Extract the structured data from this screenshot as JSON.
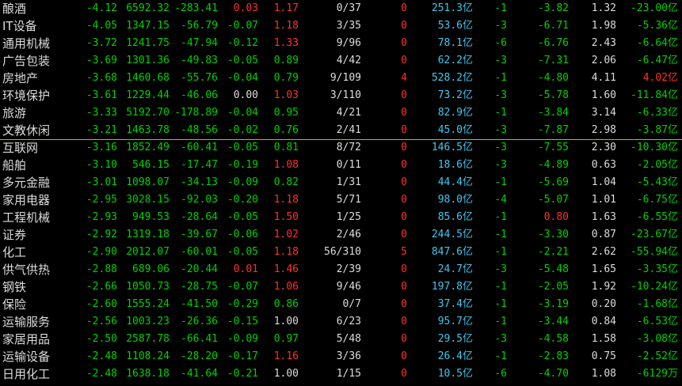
{
  "colors": {
    "background": "#000000",
    "rise": "#ff3030",
    "fall": "#00d200",
    "flat": "#dcdcdc",
    "amount": "#40c8f0",
    "divider": "#c8b400"
  },
  "rows": [
    {
      "name": "酿酒",
      "pct": "-4.12",
      "price": "6592.32",
      "chg": "-283.41",
      "spd": "0.03",
      "spd_dir": "up",
      "ratio": "1.17",
      "ratio_dir": "up",
      "ud": "0/37",
      "flag": "0",
      "flag_dir": "up",
      "amt": "251.3亿",
      "cnt": "-1",
      "val": "-3.82",
      "val_dir": "dn",
      "ratio2": "1.32",
      "flow": "-23.00亿",
      "flow_dir": "dn"
    },
    {
      "name": "IT设备",
      "pct": "-4.05",
      "price": "1347.15",
      "chg": "-56.79",
      "spd": "-0.07",
      "spd_dir": "dn",
      "ratio": "1.18",
      "ratio_dir": "up",
      "ud": "3/35",
      "flag": "0",
      "flag_dir": "up",
      "amt": "53.6亿",
      "cnt": "-3",
      "val": "-6.71",
      "val_dir": "dn",
      "ratio2": "1.98",
      "flow": "-5.36亿",
      "flow_dir": "dn"
    },
    {
      "name": "通用机械",
      "pct": "-3.72",
      "price": "1241.75",
      "chg": "-47.94",
      "spd": "-0.12",
      "spd_dir": "dn",
      "ratio": "1.33",
      "ratio_dir": "up",
      "ud": "9/96",
      "flag": "0",
      "flag_dir": "up",
      "amt": "78.1亿",
      "cnt": "-6",
      "val": "-6.76",
      "val_dir": "dn",
      "ratio2": "2.43",
      "flow": "-6.64亿",
      "flow_dir": "dn"
    },
    {
      "name": "广告包装",
      "pct": "-3.69",
      "price": "1301.36",
      "chg": "-49.83",
      "spd": "-0.05",
      "spd_dir": "dn",
      "ratio": "0.89",
      "ratio_dir": "dn",
      "ud": "4/42",
      "flag": "0",
      "flag_dir": "up",
      "amt": "62.2亿",
      "cnt": "-3",
      "val": "-7.31",
      "val_dir": "dn",
      "ratio2": "2.06",
      "flow": "-6.47亿",
      "flow_dir": "dn"
    },
    {
      "name": "房地产",
      "pct": "-3.68",
      "price": "1460.68",
      "chg": "-55.76",
      "spd": "-0.04",
      "spd_dir": "dn",
      "ratio": "0.79",
      "ratio_dir": "dn",
      "ud": "9/109",
      "flag": "4",
      "flag_dir": "up",
      "amt": "528.2亿",
      "cnt": "-1",
      "val": "-4.80",
      "val_dir": "dn",
      "ratio2": "4.11",
      "flow": "4.02亿",
      "flow_dir": "up"
    },
    {
      "name": "环境保护",
      "pct": "-3.61",
      "price": "1229.44",
      "chg": "-46.06",
      "spd": "0.00",
      "spd_dir": "eq",
      "ratio": "1.03",
      "ratio_dir": "up",
      "ud": "3/110",
      "flag": "0",
      "flag_dir": "up",
      "amt": "73.2亿",
      "cnt": "-3",
      "val": "-5.78",
      "val_dir": "dn",
      "ratio2": "1.60",
      "flow": "-11.84亿",
      "flow_dir": "dn"
    },
    {
      "name": "旅游",
      "pct": "-3.33",
      "price": "5192.70",
      "chg": "-178.89",
      "spd": "-0.04",
      "spd_dir": "dn",
      "ratio": "0.95",
      "ratio_dir": "dn",
      "ud": "4/21",
      "flag": "0",
      "flag_dir": "up",
      "amt": "82.9亿",
      "cnt": "-1",
      "val": "-3.84",
      "val_dir": "dn",
      "ratio2": "3.14",
      "flow": "-6.33亿",
      "flow_dir": "dn"
    },
    {
      "name": "文教休闲",
      "pct": "-3.21",
      "price": "1463.78",
      "chg": "-48.56",
      "spd": "-0.02",
      "spd_dir": "dn",
      "ratio": "0.76",
      "ratio_dir": "dn",
      "ud": "2/41",
      "flag": "0",
      "flag_dir": "up",
      "amt": "45.0亿",
      "cnt": "-3",
      "val": "-7.87",
      "val_dir": "dn",
      "ratio2": "2.98",
      "flow": "-3.87亿",
      "flow_dir": "dn"
    },
    {
      "name": "互联网",
      "pct": "-3.16",
      "price": "1852.49",
      "chg": "-60.41",
      "spd": "-0.05",
      "spd_dir": "dn",
      "ratio": "0.81",
      "ratio_dir": "dn",
      "ud": "8/72",
      "flag": "0",
      "flag_dir": "up",
      "amt": "146.5亿",
      "cnt": "-3",
      "val": "-7.55",
      "val_dir": "dn",
      "ratio2": "2.30",
      "flow": "-10.30亿",
      "flow_dir": "dn"
    },
    {
      "name": "船舶",
      "pct": "-3.10",
      "price": "546.15",
      "chg": "-17.47",
      "spd": "-0.19",
      "spd_dir": "dn",
      "ratio": "1.08",
      "ratio_dir": "up",
      "ud": "0/11",
      "flag": "0",
      "flag_dir": "up",
      "amt": "18.6亿",
      "cnt": "-3",
      "val": "-4.89",
      "val_dir": "dn",
      "ratio2": "0.63",
      "flow": "-2.05亿",
      "flow_dir": "dn"
    },
    {
      "name": "多元金融",
      "pct": "-3.01",
      "price": "1098.07",
      "chg": "-34.13",
      "spd": "-0.09",
      "spd_dir": "dn",
      "ratio": "0.82",
      "ratio_dir": "dn",
      "ud": "1/31",
      "flag": "0",
      "flag_dir": "up",
      "amt": "44.4亿",
      "cnt": "-1",
      "val": "-5.69",
      "val_dir": "dn",
      "ratio2": "1.04",
      "flow": "-5.43亿",
      "flow_dir": "dn"
    },
    {
      "name": "家用电器",
      "pct": "-2.95",
      "price": "3028.15",
      "chg": "-92.03",
      "spd": "-0.20",
      "spd_dir": "dn",
      "ratio": "1.18",
      "ratio_dir": "up",
      "ud": "5/71",
      "flag": "0",
      "flag_dir": "up",
      "amt": "98.0亿",
      "cnt": "-4",
      "val": "-5.07",
      "val_dir": "dn",
      "ratio2": "1.01",
      "flow": "-6.75亿",
      "flow_dir": "dn"
    },
    {
      "name": "工程机械",
      "pct": "-2.93",
      "price": "949.53",
      "chg": "-28.64",
      "spd": "-0.05",
      "spd_dir": "dn",
      "ratio": "1.50",
      "ratio_dir": "up",
      "ud": "1/25",
      "flag": "0",
      "flag_dir": "up",
      "amt": "85.6亿",
      "cnt": "-1",
      "val": "0.80",
      "val_dir": "up",
      "ratio2": "1.63",
      "flow": "-6.55亿",
      "flow_dir": "dn"
    },
    {
      "name": "证券",
      "pct": "-2.92",
      "price": "1319.18",
      "chg": "-39.67",
      "spd": "-0.06",
      "spd_dir": "dn",
      "ratio": "1.02",
      "ratio_dir": "up",
      "ud": "2/46",
      "flag": "0",
      "flag_dir": "up",
      "amt": "244.5亿",
      "cnt": "-1",
      "val": "-3.30",
      "val_dir": "dn",
      "ratio2": "0.87",
      "flow": "-23.67亿",
      "flow_dir": "dn"
    },
    {
      "name": "化工",
      "pct": "-2.90",
      "price": "2012.07",
      "chg": "-60.01",
      "spd": "-0.05",
      "spd_dir": "dn",
      "ratio": "1.18",
      "ratio_dir": "up",
      "ud": "56/310",
      "flag": "5",
      "flag_dir": "up",
      "amt": "847.6亿",
      "cnt": "-1",
      "val": "-2.21",
      "val_dir": "dn",
      "ratio2": "2.62",
      "flow": "-55.94亿",
      "flow_dir": "dn"
    },
    {
      "name": "供气供热",
      "pct": "-2.88",
      "price": "689.06",
      "chg": "-20.44",
      "spd": "0.01",
      "spd_dir": "up",
      "ratio": "1.46",
      "ratio_dir": "up",
      "ud": "2/39",
      "flag": "0",
      "flag_dir": "up",
      "amt": "24.7亿",
      "cnt": "-3",
      "val": "-5.48",
      "val_dir": "dn",
      "ratio2": "1.65",
      "flow": "-3.35亿",
      "flow_dir": "dn"
    },
    {
      "name": "钢铁",
      "pct": "-2.66",
      "price": "1050.73",
      "chg": "-28.75",
      "spd": "-0.07",
      "spd_dir": "dn",
      "ratio": "1.06",
      "ratio_dir": "up",
      "ud": "9/46",
      "flag": "0",
      "flag_dir": "up",
      "amt": "197.8亿",
      "cnt": "-1",
      "val": "-2.05",
      "val_dir": "dn",
      "ratio2": "1.92",
      "flow": "-10.24亿",
      "flow_dir": "dn"
    },
    {
      "name": "保险",
      "pct": "-2.60",
      "price": "1555.24",
      "chg": "-41.50",
      "spd": "-0.29",
      "spd_dir": "dn",
      "ratio": "0.86",
      "ratio_dir": "dn",
      "ud": "0/7",
      "flag": "0",
      "flag_dir": "up",
      "amt": "37.4亿",
      "cnt": "-1",
      "val": "-3.19",
      "val_dir": "dn",
      "ratio2": "0.20",
      "flow": "-1.68亿",
      "flow_dir": "dn"
    },
    {
      "name": "运输服务",
      "pct": "-2.56",
      "price": "1003.23",
      "chg": "-26.36",
      "spd": "-0.15",
      "spd_dir": "dn",
      "ratio": "1.00",
      "ratio_dir": "eq",
      "ud": "6/23",
      "flag": "0",
      "flag_dir": "up",
      "amt": "95.7亿",
      "cnt": "-1",
      "val": "-3.44",
      "val_dir": "dn",
      "ratio2": "0.84",
      "flow": "-6.53亿",
      "flow_dir": "dn"
    },
    {
      "name": "家居用品",
      "pct": "-2.50",
      "price": "2587.78",
      "chg": "-66.41",
      "spd": "-0.09",
      "spd_dir": "dn",
      "ratio": "0.97",
      "ratio_dir": "dn",
      "ud": "5/48",
      "flag": "0",
      "flag_dir": "up",
      "amt": "29.5亿",
      "cnt": "-3",
      "val": "-4.58",
      "val_dir": "dn",
      "ratio2": "1.58",
      "flow": "-3.08亿",
      "flow_dir": "dn"
    },
    {
      "name": "运输设备",
      "pct": "-2.48",
      "price": "1108.24",
      "chg": "-28.20",
      "spd": "-0.17",
      "spd_dir": "dn",
      "ratio": "1.16",
      "ratio_dir": "up",
      "ud": "3/36",
      "flag": "0",
      "flag_dir": "up",
      "amt": "26.4亿",
      "cnt": "-1",
      "val": "-2.83",
      "val_dir": "dn",
      "ratio2": "0.75",
      "flow": "-2.52亿",
      "flow_dir": "dn"
    },
    {
      "name": "日用化工",
      "pct": "-2.48",
      "price": "1638.18",
      "chg": "-41.64",
      "spd": "-0.21",
      "spd_dir": "dn",
      "ratio": "1.00",
      "ratio_dir": "eq",
      "ud": "1/15",
      "flag": "0",
      "flag_dir": "up",
      "amt": "10.5亿",
      "cnt": "-6",
      "val": "-4.70",
      "val_dir": "dn",
      "ratio2": "1.08",
      "flow": "-6129万",
      "flow_dir": "dn"
    }
  ]
}
